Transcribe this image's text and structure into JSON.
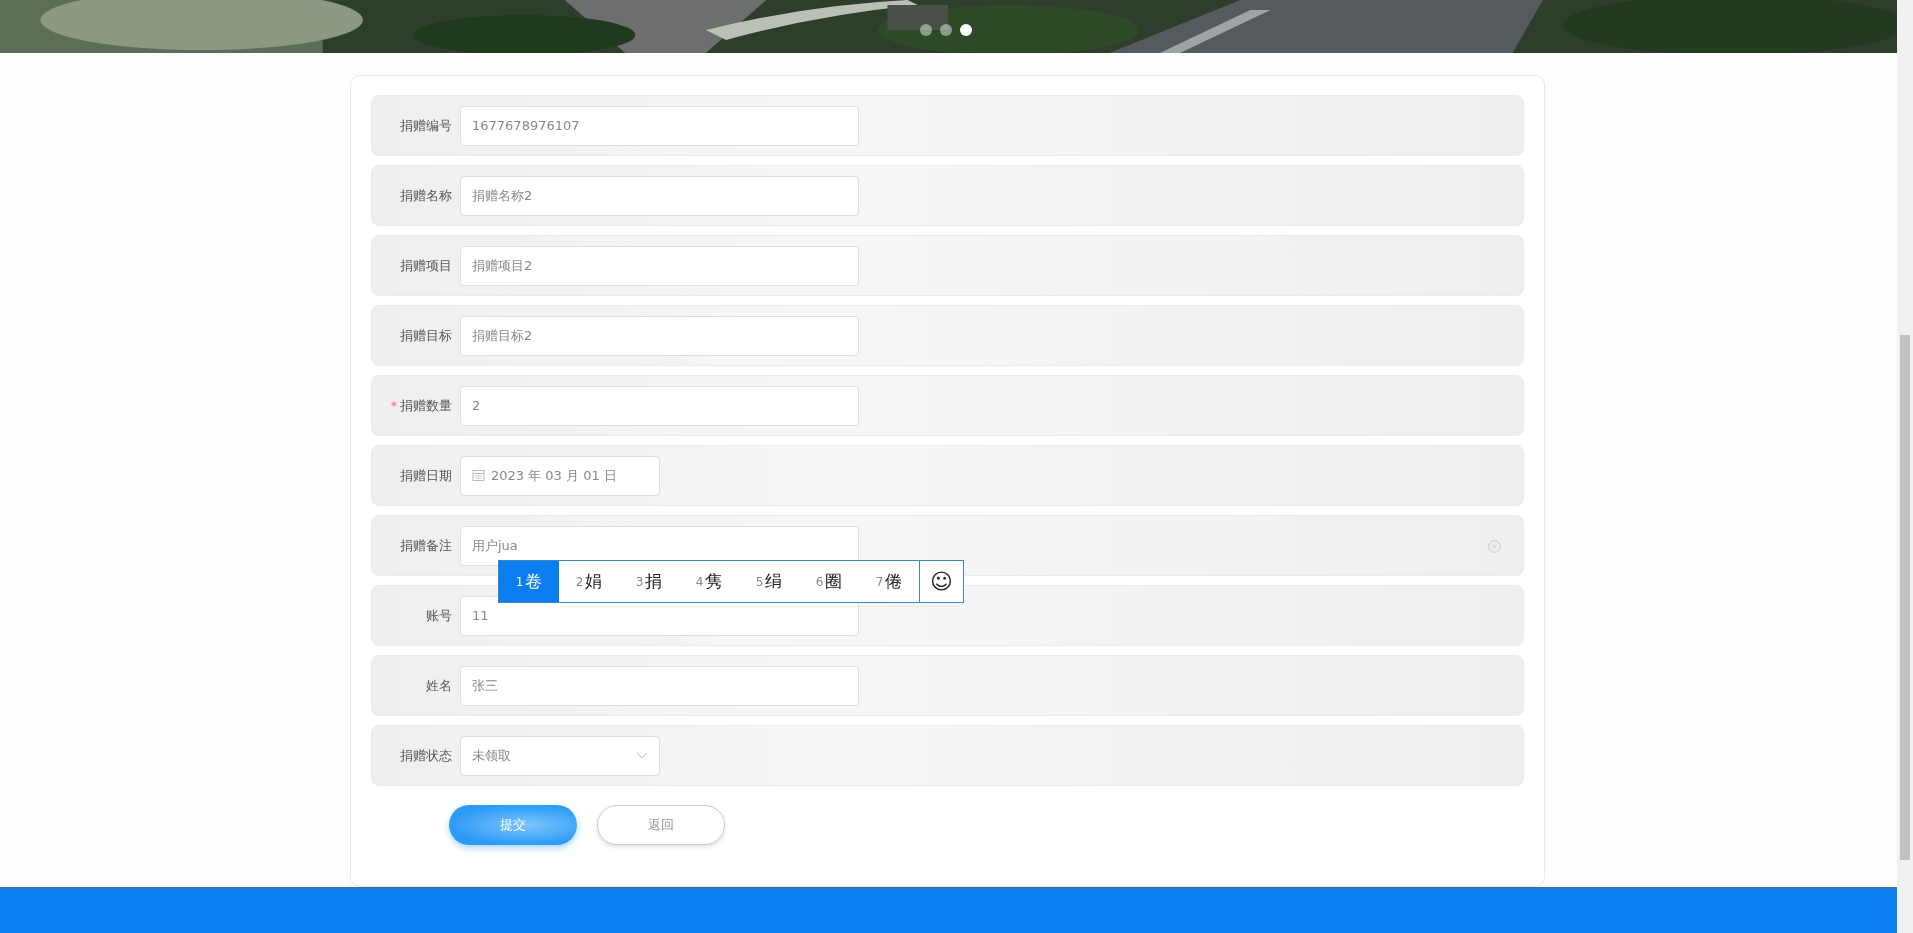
{
  "carousel": {
    "dots": [
      {
        "selected": false
      },
      {
        "selected": false
      },
      {
        "selected": true
      }
    ]
  },
  "form": {
    "fields": [
      {
        "label": "捐赠编号",
        "kind": "text",
        "value": "1677678976107",
        "clear_icon": false
      },
      {
        "label": "捐赠名称",
        "kind": "text",
        "value": "捐赠名称2",
        "clear_icon": false
      },
      {
        "label": "捐赠项目",
        "kind": "text",
        "value": "捐赠项目2",
        "clear_icon": false
      },
      {
        "label": "捐赠目标",
        "kind": "text",
        "value": "捐赠目标2",
        "clear_icon": false
      },
      {
        "label": "捐赠数量",
        "kind": "text",
        "value": "2",
        "required_mark": "*",
        "clear_icon": false
      },
      {
        "label": "捐赠日期",
        "kind": "date",
        "value": "2023 年 03 月 01 日",
        "clear_icon": false
      },
      {
        "label": "捐赠备注",
        "kind": "text",
        "value": "用户jua",
        "clear_icon": true
      },
      {
        "label": "账号",
        "kind": "text",
        "value": "11",
        "clear_icon": false
      },
      {
        "label": "姓名",
        "kind": "text",
        "value": "张三",
        "clear_icon": false
      },
      {
        "label": "捐赠状态",
        "kind": "select",
        "value": "未领取",
        "clear_icon": false
      }
    ],
    "buttons": [
      {
        "label": "提交",
        "kind": "primary"
      },
      {
        "label": "返回",
        "kind": "plain"
      }
    ]
  },
  "ime_candidates": {
    "candidates": [
      {
        "number": "1",
        "char": "卷",
        "selected": true
      },
      {
        "number": "2",
        "char": "娟",
        "selected": false
      },
      {
        "number": "3",
        "char": "捐",
        "selected": false
      },
      {
        "number": "4",
        "char": "隽",
        "selected": false
      },
      {
        "number": "5",
        "char": "绢",
        "selected": false
      },
      {
        "number": "6",
        "char": "圈",
        "selected": false
      },
      {
        "number": "7",
        "char": "倦",
        "selected": false
      }
    ],
    "emoji": "☺"
  }
}
